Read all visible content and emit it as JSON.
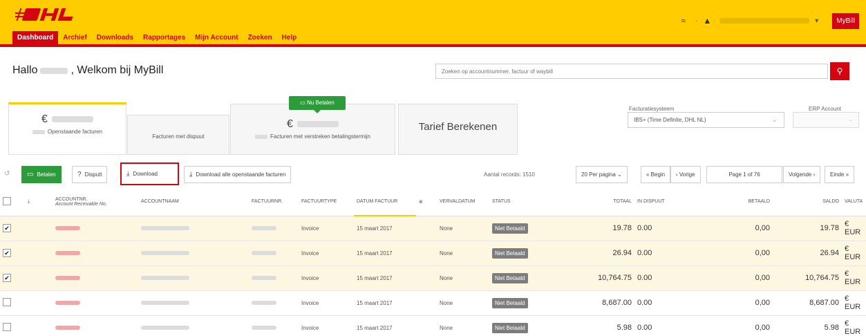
{
  "header": {
    "brand_color": "#ffcc00",
    "accent_color": "#d40511",
    "nav": [
      {
        "label": "Dashboard",
        "active": true
      },
      {
        "label": "Archief"
      },
      {
        "label": "Downloads"
      },
      {
        "label": "Rapportages"
      },
      {
        "label": "Mijn Account"
      },
      {
        "label": "Zoeken"
      },
      {
        "label": "Help"
      }
    ],
    "mybill_label": "MyBill"
  },
  "welcome": {
    "prefix": "Hallo",
    "suffix": ", Welkom bij MyBill"
  },
  "search": {
    "placeholder": "Zoeken op accountnummer, factuur of waybill"
  },
  "cards": {
    "open": {
      "currency": "€",
      "label": "Openstaande facturen"
    },
    "dispute": {
      "label": "Facturen met dispuut"
    },
    "overdue": {
      "currency": "€",
      "label": "Facturen met verstreken betalingstermijn",
      "pay_now": "Nu Betalen"
    },
    "tariff": {
      "label": "Tarief Berekenen"
    }
  },
  "filters": {
    "system_label": "Facturatiesysteem",
    "system_value": "IBS+ (Time Definite, DHL NL)",
    "erp_label": "ERP Account"
  },
  "toolbar": {
    "pay": "Betalen",
    "dispute": "Disputt",
    "download": "Download",
    "download_all": "Download alle openstaande facturen",
    "records": "Aantal records: 1510",
    "per_page": "20 Per pagina",
    "begin": "« Begin",
    "prev": "‹ Vorige",
    "page": "Page 1 of 76",
    "next": "Volgende ›",
    "end": "Einde »"
  },
  "table": {
    "headers": {
      "account": "ACCOUNTNR.",
      "account_sub": "Account Receivable No.",
      "name": "ACCOUNTNAAM",
      "invoice_no": "FACTUURNR.",
      "invoice_type": "FACTUURTYPE",
      "invoice_date": "DATUM FACTUUR",
      "due_date": "VERVALDATUM",
      "status": "STATUS",
      "total": "TOTAAL",
      "disputed": "IN DISPUUT",
      "paid": "BETAALD",
      "balance": "SALDO",
      "currency": "VALUTA"
    },
    "rows": [
      {
        "checked": true,
        "type": "Invoice",
        "date": "15 maart 2017",
        "due": "None",
        "status": "Niet Betaald",
        "total": "19.78",
        "disputed": "0.00",
        "paid": "0,00",
        "balance": "19.78",
        "currency": "€ EUR"
      },
      {
        "checked": true,
        "type": "Invoice",
        "date": "15 maart 2017",
        "due": "None",
        "status": "Niet Betaald",
        "total": "26.94",
        "disputed": "0.00",
        "paid": "0,00",
        "balance": "26.94",
        "currency": "€ EUR"
      },
      {
        "checked": true,
        "type": "Invoice",
        "date": "15 maart 2017",
        "due": "None",
        "status": "Niet Betaald",
        "total": "10,764.75",
        "disputed": "0.00",
        "paid": "0,00",
        "balance": "10,764.75",
        "currency": "€ EUR"
      },
      {
        "checked": false,
        "type": "Invoice",
        "date": "15 maart 2017",
        "due": "None",
        "status": "Niet Betaald",
        "total": "8,687.00",
        "disputed": "0.00",
        "paid": "0,00",
        "balance": "8,687.00",
        "currency": "€ EUR"
      },
      {
        "checked": false,
        "type": "Invoice",
        "date": "15 maart 2017",
        "due": "None",
        "status": "Niet Betaald",
        "total": "5.98",
        "disputed": "0.00",
        "paid": "0,00",
        "balance": "5.98",
        "currency": "€ EUR"
      }
    ]
  }
}
